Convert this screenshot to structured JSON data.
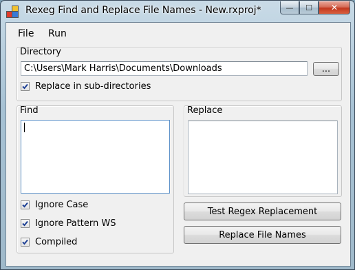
{
  "window": {
    "title": "Rexeg Find and Replace File Names - New.rxproj*",
    "icon": "app-icon",
    "controls": {
      "minimize": "—",
      "maximize": "☐",
      "close": "✕"
    }
  },
  "menu": {
    "items": [
      "File",
      "Run"
    ]
  },
  "directory": {
    "group_label": "Directory",
    "path_value": "C:\\Users\\Mark Harris\\Documents\\Downloads",
    "browse_label": "...",
    "recursive": {
      "label": "Replace in sub-directories",
      "checked": true
    }
  },
  "find": {
    "group_label": "Find",
    "value": "",
    "options": [
      {
        "label": "Ignore Case",
        "checked": true
      },
      {
        "label": "Ignore Pattern WS",
        "checked": true
      },
      {
        "label": "Compiled",
        "checked": true
      }
    ]
  },
  "replace": {
    "group_label": "Replace",
    "value": "",
    "test_button_label": "Test Regex Replacement",
    "replace_button_label": "Replace File Names"
  },
  "colors": {
    "accent": "#0066cc",
    "client_bg": "#f0f0f0",
    "close_button": "#c2381f"
  }
}
